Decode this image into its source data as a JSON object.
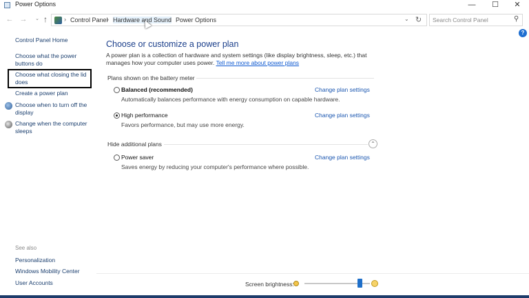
{
  "window": {
    "title": "Power Options",
    "controls": {
      "minimize": "—",
      "maximize": "☐",
      "close": "✕"
    }
  },
  "navigation": {
    "back": "←",
    "forward": "→",
    "recent": "⌄",
    "up": "↑",
    "breadcrumbs": [
      {
        "label": "Control Panel"
      },
      {
        "label": "Hardware and Sound"
      },
      {
        "label": "Power Options"
      }
    ],
    "separator": "›",
    "dropdown": "⌄",
    "refresh": "↻",
    "search_placeholder": "Search Control Panel",
    "search_icon": "⚲"
  },
  "sidebar": {
    "home": "Control Panel Home",
    "links": [
      {
        "label": "Choose what the power buttons do"
      },
      {
        "label": "Choose what closing the lid does",
        "highlighted": true
      },
      {
        "label": "Create a power plan"
      },
      {
        "label": "Choose when to turn off the display",
        "icon": "display-shield-icon"
      },
      {
        "label": "Change when the computer sleeps",
        "icon": "moon-globe-icon"
      }
    ],
    "see_also_header": "See also",
    "see_also": [
      {
        "label": "Personalization"
      },
      {
        "label": "Windows Mobility Center"
      },
      {
        "label": "User Accounts"
      }
    ]
  },
  "main": {
    "title": "Choose or customize a power plan",
    "description": "A power plan is a collection of hardware and system settings (like display brightness, sleep, etc.) that manages how your computer uses power.",
    "more_link": "Tell me more about power plans",
    "section_battery": "Plans shown on the battery meter",
    "section_hidden": "Hide additional plans",
    "collapse_icon": "⌃",
    "plans": [
      {
        "name": "Balanced (recommended)",
        "description": "Automatically balances performance with energy consumption on capable hardware.",
        "selected": false,
        "link": "Change plan settings"
      },
      {
        "name": "High performance",
        "description": "Favors performance, but may use more energy.",
        "selected": true,
        "link": "Change plan settings"
      },
      {
        "name": "Power saver",
        "description": "Saves energy by reducing your computer's performance where possible.",
        "selected": false,
        "link": "Change plan settings"
      }
    ],
    "help": "?"
  },
  "footer": {
    "brightness_label": "Screen brightness:",
    "brightness_level": 0.85
  }
}
